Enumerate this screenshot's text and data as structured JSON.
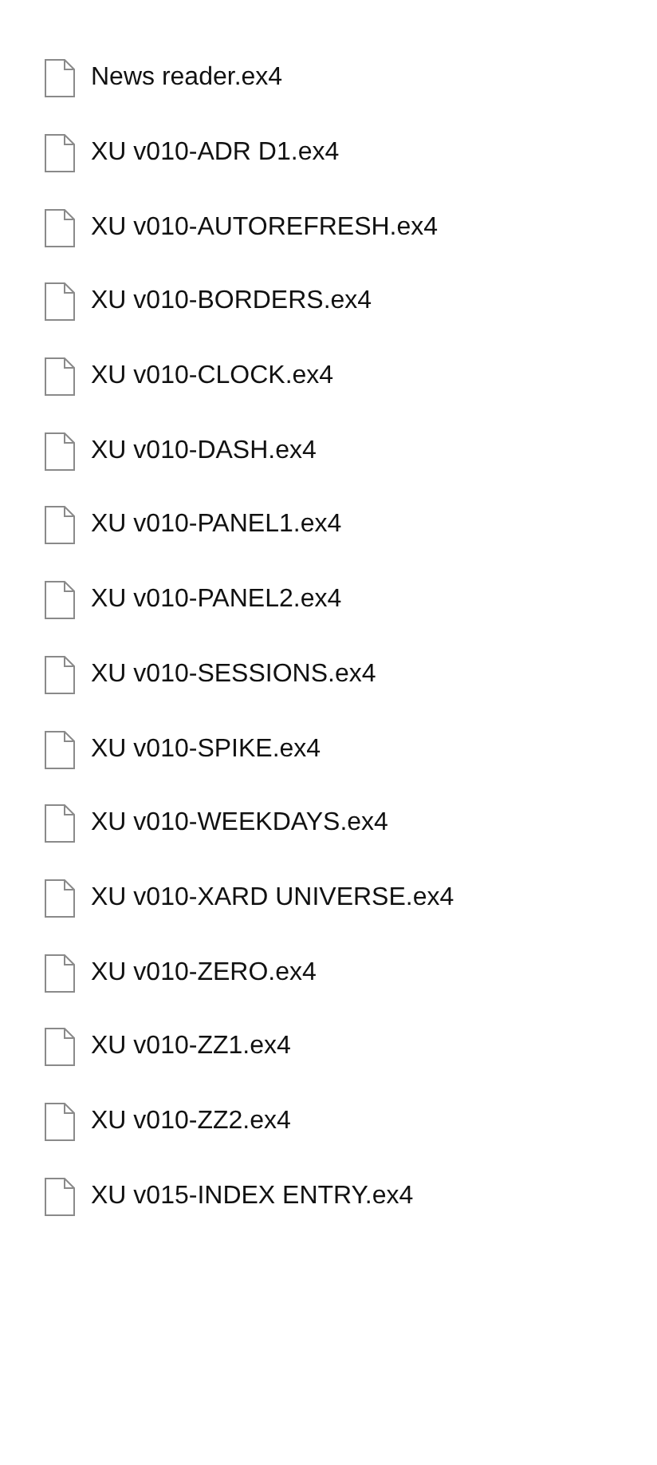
{
  "files": [
    {
      "name": "News reader.ex4"
    },
    {
      "name": "XU v010-ADR D1.ex4"
    },
    {
      "name": "XU v010-AUTOREFRESH.ex4"
    },
    {
      "name": "XU v010-BORDERS.ex4"
    },
    {
      "name": "XU v010-CLOCK.ex4"
    },
    {
      "name": "XU v010-DASH.ex4"
    },
    {
      "name": "XU v010-PANEL1.ex4"
    },
    {
      "name": "XU v010-PANEL2.ex4"
    },
    {
      "name": "XU v010-SESSIONS.ex4"
    },
    {
      "name": "XU v010-SPIKE.ex4"
    },
    {
      "name": "XU v010-WEEKDAYS.ex4"
    },
    {
      "name": "XU v010-XARD UNIVERSE.ex4"
    },
    {
      "name": "XU v010-ZERO.ex4"
    },
    {
      "name": "XU v010-ZZ1.ex4"
    },
    {
      "name": "XU v010-ZZ2.ex4"
    },
    {
      "name": "XU v015-INDEX ENTRY.ex4"
    }
  ]
}
